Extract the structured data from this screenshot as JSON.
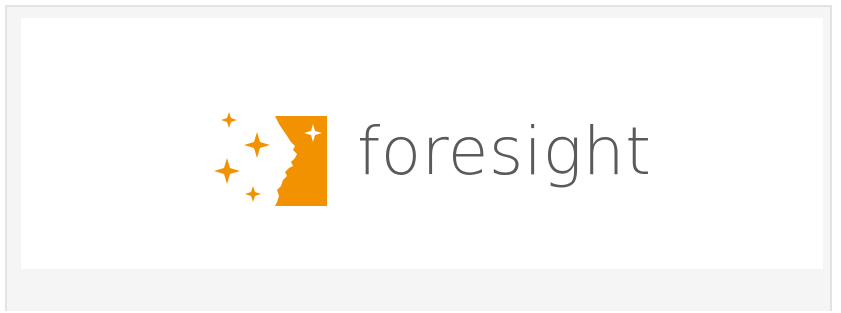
{
  "brand": {
    "name": "foresight",
    "accent_color": "#f39200",
    "text_color": "#5a5a5a"
  }
}
